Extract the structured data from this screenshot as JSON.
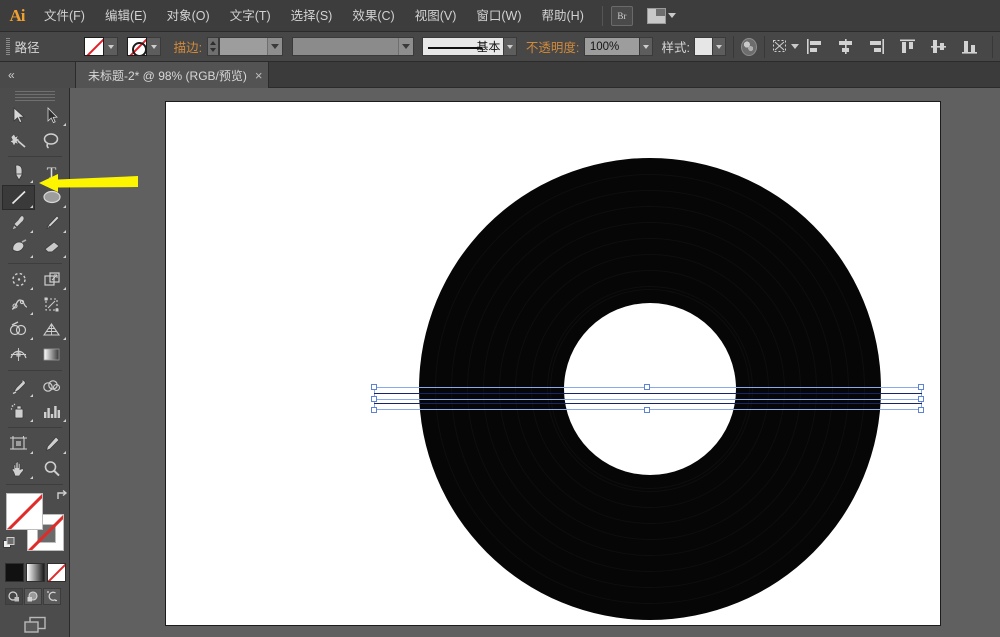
{
  "app": {
    "name": "Adobe Illustrator",
    "logo_text": "Ai"
  },
  "menubar": {
    "items": [
      {
        "label": "文件(F)",
        "name": "menu-file"
      },
      {
        "label": "编辑(E)",
        "name": "menu-edit"
      },
      {
        "label": "对象(O)",
        "name": "menu-object"
      },
      {
        "label": "文字(T)",
        "name": "menu-type"
      },
      {
        "label": "选择(S)",
        "name": "menu-select"
      },
      {
        "label": "效果(C)",
        "name": "menu-effect"
      },
      {
        "label": "视图(V)",
        "name": "menu-view"
      },
      {
        "label": "窗口(W)",
        "name": "menu-window"
      },
      {
        "label": "帮助(H)",
        "name": "menu-help"
      }
    ],
    "bridge_label": "Br",
    "arrange_documents_label": ""
  },
  "control_bar": {
    "object_type_label": "路径",
    "fill_value": "无",
    "stroke_swatch_value": "无",
    "stroke_label": "描边:",
    "stroke_weight_value": "",
    "stroke_style_value": "",
    "stroke_profile_label": "基本",
    "opacity_label": "不透明度:",
    "opacity_value": "100%",
    "style_label": "样式:",
    "align_items": [
      "align-left-icon",
      "align-center-horizontal-icon",
      "align-right-icon",
      "align-top-icon",
      "align-middle-vertical-icon",
      "align-bottom-icon"
    ]
  },
  "tabstrip": {
    "collapse_label": "«",
    "document_title": "未标题-2* @ 98% (RGB/预览)",
    "close_label": "×"
  },
  "tools": {
    "rows": [
      [
        {
          "label": "选择工具",
          "name": "tool-selection"
        },
        {
          "label": "直接选择工具",
          "name": "tool-direct-selection"
        }
      ],
      [
        {
          "label": "魔棒工具",
          "name": "tool-magic-wand"
        },
        {
          "label": "套索工具",
          "name": "tool-lasso"
        }
      ],
      [
        {
          "label": "钢笔工具",
          "name": "tool-pen"
        },
        {
          "label": "文字工具",
          "name": "tool-type"
        }
      ],
      [
        {
          "label": "直线段工具",
          "name": "tool-line-segment"
        },
        {
          "label": "椭圆工具",
          "name": "tool-ellipse"
        }
      ],
      [
        {
          "label": "画笔工具",
          "name": "tool-paintbrush"
        },
        {
          "label": "铅笔工具",
          "name": "tool-pencil"
        }
      ],
      [
        {
          "label": "斑点画笔工具",
          "name": "tool-blob-brush"
        },
        {
          "label": "橡皮擦工具",
          "name": "tool-eraser"
        }
      ],
      [
        {
          "label": "旋转工具",
          "name": "tool-rotate"
        },
        {
          "label": "缩放工具",
          "name": "tool-scale"
        }
      ],
      [
        {
          "label": "宽度工具",
          "name": "tool-width"
        },
        {
          "label": "自由变换工具",
          "name": "tool-free-transform"
        }
      ],
      [
        {
          "label": "形状生成器工具",
          "name": "tool-shape-builder"
        },
        {
          "label": "透视网格工具",
          "name": "tool-perspective-grid"
        }
      ],
      [
        {
          "label": "网格工具",
          "name": "tool-mesh"
        },
        {
          "label": "渐变工具",
          "name": "tool-gradient"
        }
      ],
      [
        {
          "label": "吸管工具",
          "name": "tool-eyedropper"
        },
        {
          "label": "混合工具",
          "name": "tool-blend"
        }
      ],
      [
        {
          "label": "符号喷枪工具",
          "name": "tool-symbol-sprayer"
        },
        {
          "label": "柱形图工具",
          "name": "tool-column-graph"
        }
      ],
      [
        {
          "label": "画板工具",
          "name": "tool-artboard"
        },
        {
          "label": "切片工具",
          "name": "tool-slice"
        }
      ],
      [
        {
          "label": "抓手工具",
          "name": "tool-hand"
        },
        {
          "label": "缩放显示工具",
          "name": "tool-zoom"
        }
      ]
    ],
    "active_tool": "tool-line-segment",
    "fill_state": "无",
    "stroke_state": "无",
    "color_modes": [
      {
        "name": "mode-color",
        "label": "颜色"
      },
      {
        "name": "mode-gradient",
        "label": "渐变"
      },
      {
        "name": "mode-none",
        "label": "无"
      }
    ],
    "draw_modes": [
      {
        "name": "draw-normal",
        "label": "正常绘图"
      },
      {
        "name": "draw-behind",
        "label": "背面绘图"
      },
      {
        "name": "draw-inside",
        "label": "内部绘图"
      }
    ],
    "screen_mode": {
      "name": "screen-mode",
      "label": "更改屏幕模式"
    }
  },
  "canvas": {
    "zoom_level": "98%",
    "shape": {
      "name": "vinyl-record",
      "groove_count": 9
    },
    "selection": {
      "label": "已选择路径",
      "path_count": 2,
      "handle_count": 8
    },
    "annotation": {
      "name": "yellow-arrow-annotation",
      "color": "#fdf500",
      "points_to": "tool-line-segment"
    }
  },
  "colors": {
    "chrome_dark": "#3d3d3d",
    "chrome_mid": "#474747",
    "panel": "#4c4c4c",
    "canvas_bg": "#606060",
    "artboard": "#ffffff",
    "shape_black": "#060606",
    "selection_blue": "#8aa9e8",
    "path_navy": "#16256e",
    "accent_orange": "#d08a3c",
    "annotation_yellow": "#fdf500"
  }
}
